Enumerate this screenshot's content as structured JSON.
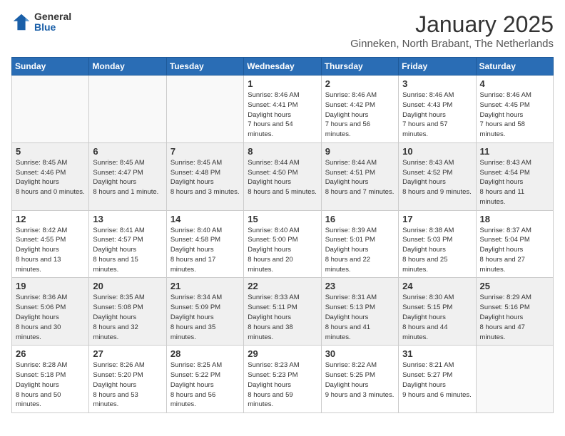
{
  "logo": {
    "general": "General",
    "blue": "Blue"
  },
  "header": {
    "title": "January 2025",
    "subtitle": "Ginneken, North Brabant, The Netherlands"
  },
  "weekdays": [
    "Sunday",
    "Monday",
    "Tuesday",
    "Wednesday",
    "Thursday",
    "Friday",
    "Saturday"
  ],
  "weeks": [
    [
      {
        "day": "",
        "empty": true
      },
      {
        "day": "",
        "empty": true
      },
      {
        "day": "",
        "empty": true
      },
      {
        "day": "1",
        "sunrise": "8:46 AM",
        "sunset": "4:41 PM",
        "daylight": "7 hours and 54 minutes."
      },
      {
        "day": "2",
        "sunrise": "8:46 AM",
        "sunset": "4:42 PM",
        "daylight": "7 hours and 56 minutes."
      },
      {
        "day": "3",
        "sunrise": "8:46 AM",
        "sunset": "4:43 PM",
        "daylight": "7 hours and 57 minutes."
      },
      {
        "day": "4",
        "sunrise": "8:46 AM",
        "sunset": "4:45 PM",
        "daylight": "7 hours and 58 minutes."
      }
    ],
    [
      {
        "day": "5",
        "sunrise": "8:45 AM",
        "sunset": "4:46 PM",
        "daylight": "8 hours and 0 minutes."
      },
      {
        "day": "6",
        "sunrise": "8:45 AM",
        "sunset": "4:47 PM",
        "daylight": "8 hours and 1 minute."
      },
      {
        "day": "7",
        "sunrise": "8:45 AM",
        "sunset": "4:48 PM",
        "daylight": "8 hours and 3 minutes."
      },
      {
        "day": "8",
        "sunrise": "8:44 AM",
        "sunset": "4:50 PM",
        "daylight": "8 hours and 5 minutes."
      },
      {
        "day": "9",
        "sunrise": "8:44 AM",
        "sunset": "4:51 PM",
        "daylight": "8 hours and 7 minutes."
      },
      {
        "day": "10",
        "sunrise": "8:43 AM",
        "sunset": "4:52 PM",
        "daylight": "8 hours and 9 minutes."
      },
      {
        "day": "11",
        "sunrise": "8:43 AM",
        "sunset": "4:54 PM",
        "daylight": "8 hours and 11 minutes."
      }
    ],
    [
      {
        "day": "12",
        "sunrise": "8:42 AM",
        "sunset": "4:55 PM",
        "daylight": "8 hours and 13 minutes."
      },
      {
        "day": "13",
        "sunrise": "8:41 AM",
        "sunset": "4:57 PM",
        "daylight": "8 hours and 15 minutes."
      },
      {
        "day": "14",
        "sunrise": "8:40 AM",
        "sunset": "4:58 PM",
        "daylight": "8 hours and 17 minutes."
      },
      {
        "day": "15",
        "sunrise": "8:40 AM",
        "sunset": "5:00 PM",
        "daylight": "8 hours and 20 minutes."
      },
      {
        "day": "16",
        "sunrise": "8:39 AM",
        "sunset": "5:01 PM",
        "daylight": "8 hours and 22 minutes."
      },
      {
        "day": "17",
        "sunrise": "8:38 AM",
        "sunset": "5:03 PM",
        "daylight": "8 hours and 25 minutes."
      },
      {
        "day": "18",
        "sunrise": "8:37 AM",
        "sunset": "5:04 PM",
        "daylight": "8 hours and 27 minutes."
      }
    ],
    [
      {
        "day": "19",
        "sunrise": "8:36 AM",
        "sunset": "5:06 PM",
        "daylight": "8 hours and 30 minutes."
      },
      {
        "day": "20",
        "sunrise": "8:35 AM",
        "sunset": "5:08 PM",
        "daylight": "8 hours and 32 minutes."
      },
      {
        "day": "21",
        "sunrise": "8:34 AM",
        "sunset": "5:09 PM",
        "daylight": "8 hours and 35 minutes."
      },
      {
        "day": "22",
        "sunrise": "8:33 AM",
        "sunset": "5:11 PM",
        "daylight": "8 hours and 38 minutes."
      },
      {
        "day": "23",
        "sunrise": "8:31 AM",
        "sunset": "5:13 PM",
        "daylight": "8 hours and 41 minutes."
      },
      {
        "day": "24",
        "sunrise": "8:30 AM",
        "sunset": "5:15 PM",
        "daylight": "8 hours and 44 minutes."
      },
      {
        "day": "25",
        "sunrise": "8:29 AM",
        "sunset": "5:16 PM",
        "daylight": "8 hours and 47 minutes."
      }
    ],
    [
      {
        "day": "26",
        "sunrise": "8:28 AM",
        "sunset": "5:18 PM",
        "daylight": "8 hours and 50 minutes."
      },
      {
        "day": "27",
        "sunrise": "8:26 AM",
        "sunset": "5:20 PM",
        "daylight": "8 hours and 53 minutes."
      },
      {
        "day": "28",
        "sunrise": "8:25 AM",
        "sunset": "5:22 PM",
        "daylight": "8 hours and 56 minutes."
      },
      {
        "day": "29",
        "sunrise": "8:23 AM",
        "sunset": "5:23 PM",
        "daylight": "8 hours and 59 minutes."
      },
      {
        "day": "30",
        "sunrise": "8:22 AM",
        "sunset": "5:25 PM",
        "daylight": "9 hours and 3 minutes."
      },
      {
        "day": "31",
        "sunrise": "8:21 AM",
        "sunset": "5:27 PM",
        "daylight": "9 hours and 6 minutes."
      },
      {
        "day": "",
        "empty": true
      }
    ]
  ]
}
